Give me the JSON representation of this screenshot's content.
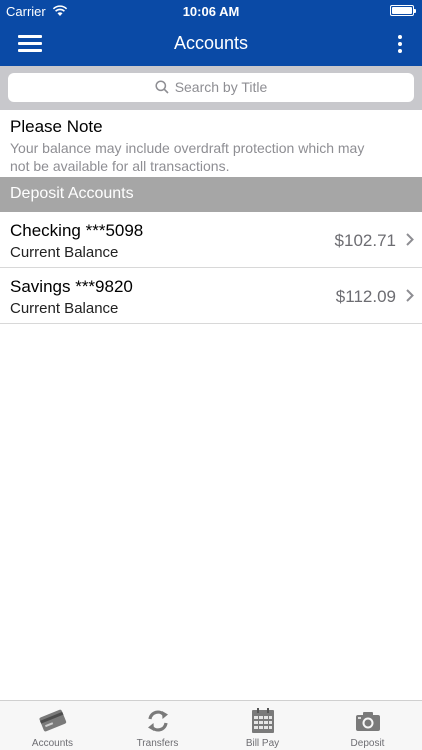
{
  "status_bar": {
    "carrier": "Carrier",
    "time": "10:06 AM",
    "icons": [
      "wifi-icon",
      "battery-icon"
    ]
  },
  "nav": {
    "title": "Accounts",
    "menu_icon": "hamburger-menu-icon",
    "more_icon": "more-vertical-icon"
  },
  "search": {
    "placeholder": "Search by Title",
    "icon": "search-icon"
  },
  "note": {
    "heading": "Please Note",
    "body_line1": "Your balance may include overdraft protection which may",
    "body_line2": "not be available for all transactions."
  },
  "section": {
    "title": "Deposit Accounts"
  },
  "accounts": [
    {
      "name": "Checking ***5098",
      "subtitle": "Current Balance",
      "balance": "$102.71"
    },
    {
      "name": "Savings ***9820",
      "subtitle": "Current Balance",
      "balance": "$112.09"
    }
  ],
  "tabs": [
    {
      "label": "Accounts",
      "icon": "card-icon"
    },
    {
      "label": "Transfers",
      "icon": "transfer-icon"
    },
    {
      "label": "Bill Pay",
      "icon": "calendar-icon"
    },
    {
      "label": "Deposit",
      "icon": "camera-icon"
    }
  ],
  "colors": {
    "brand_blue": "#0a4aa6",
    "section_gray": "#a6a6a6",
    "search_bar_gray": "#c8c8cc"
  }
}
